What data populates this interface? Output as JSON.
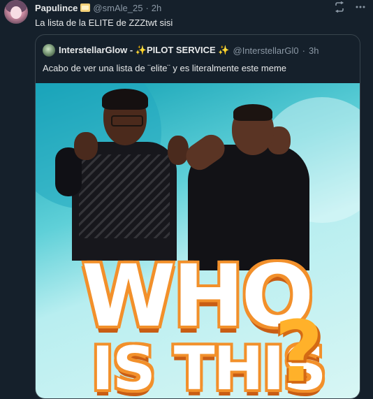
{
  "tweet": {
    "author_name": "Papulince",
    "handle": "@smAle_25",
    "separator": "·",
    "time": "2h",
    "text": "La lista de la ELITE de ZZZtwt sisi"
  },
  "quote": {
    "author_name": "InterstellarGlow - ✨PILOT SERVICE ✨",
    "handle": "@InterstellarGl0",
    "separator": "·",
    "time": "3h",
    "text": "Acabo de ver una lista de ¨elite¨ y es literalmente este meme"
  },
  "media": {
    "line1": "WHO",
    "line2": "IS THIS",
    "mark": "?"
  },
  "icons": {
    "retweet": "retweet-icon",
    "more": "more-icon"
  },
  "colors": {
    "background": "#15202b",
    "secondary_text": "#8b98a5",
    "border": "#38444d"
  }
}
